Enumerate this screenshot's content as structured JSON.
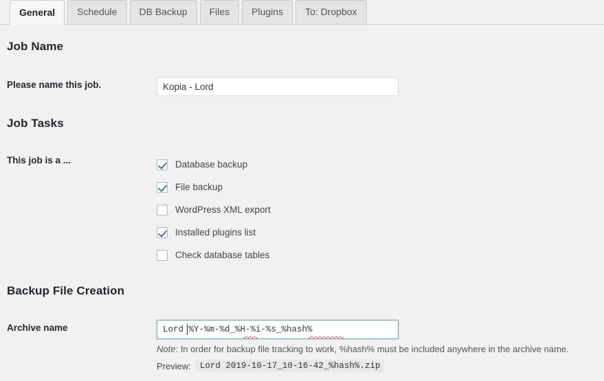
{
  "tabs": [
    {
      "label": "General",
      "active": true
    },
    {
      "label": "Schedule",
      "active": false
    },
    {
      "label": "DB Backup",
      "active": false
    },
    {
      "label": "Files",
      "active": false
    },
    {
      "label": "Plugins",
      "active": false
    },
    {
      "label": "To: Dropbox",
      "active": false
    }
  ],
  "sections": {
    "job_name": {
      "title": "Job Name",
      "label": "Please name this job.",
      "input_value": "Kopia - Lord",
      "input_placeholder": ""
    },
    "job_tasks": {
      "title": "Job Tasks",
      "label": "This job is a ...",
      "tasks": [
        {
          "label": "Database backup",
          "checked": true
        },
        {
          "label": "File backup",
          "checked": true
        },
        {
          "label": "WordPress XML export",
          "checked": false
        },
        {
          "label": "Installed plugins list",
          "checked": true
        },
        {
          "label": "Check database tables",
          "checked": false
        }
      ]
    },
    "backup_file_creation": {
      "title": "Backup File Creation",
      "label": "Archive name",
      "input_value": "Lord %Y-%m-%d_%H-%i-%s_%hash%",
      "input_placeholder": "",
      "note_prefix": "Note",
      "note_text": ": In order for backup file tracking to work, %hash% must be included anywhere in the archive name.",
      "preview_label": "Preview:",
      "preview_value": "Lord 2019-10-17_10-16-42_%hash%.zip"
    }
  },
  "colors": {
    "page_background": "#f1f1f1",
    "active_tab_background": "#f7f7f7",
    "inactive_tab_background": "#e4e4e4",
    "focus_border": "#7aa7ad",
    "checkmark": "#3a7e8c",
    "spellcheck_underline": "#e03131"
  }
}
